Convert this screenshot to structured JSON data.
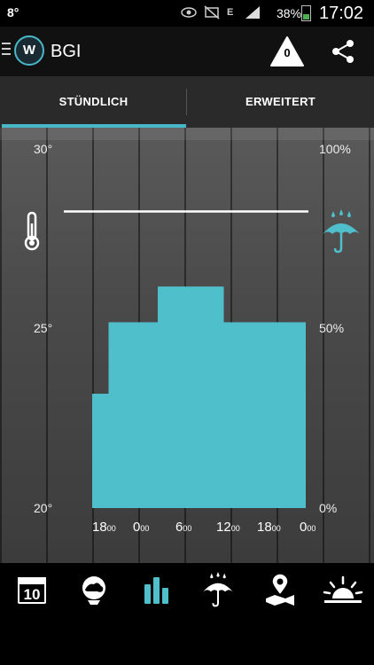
{
  "status_bar": {
    "notification": "8°",
    "battery_pct": "38%",
    "battery_level": 0.38,
    "network": "E",
    "time": "17:02"
  },
  "action_bar": {
    "title": "BGI",
    "logo_text": "W",
    "warning_count": "0"
  },
  "tabs": [
    {
      "label": "STÜNDLICH",
      "active": true
    },
    {
      "label": "ERWEITERT",
      "active": false
    }
  ],
  "chart": {
    "left_axis": {
      "top": "30°",
      "mid": "25°",
      "bottom": "20°"
    },
    "right_axis": {
      "top": "100%",
      "mid": "50%",
      "bottom": "0%"
    },
    "x_ticks": [
      {
        "hour": "18",
        "min": "00"
      },
      {
        "hour": "0",
        "min": "00"
      },
      {
        "hour": "6",
        "min": "00"
      },
      {
        "hour": "12",
        "min": "00"
      },
      {
        "hour": "18",
        "min": "00"
      },
      {
        "hour": "0",
        "min": "00"
      }
    ]
  },
  "chart_data": {
    "type": "bar",
    "temp_ylim": [
      20,
      30
    ],
    "precip_ylim": [
      0,
      100
    ],
    "temperature_line": [
      {
        "hours": 0,
        "value": 28.3
      },
      {
        "hours": 30,
        "value": 28.3
      }
    ],
    "precip_probability": [
      {
        "start": 0,
        "end": 2,
        "value": 32
      },
      {
        "start": 2,
        "end": 8,
        "value": 52
      },
      {
        "start": 8,
        "end": 16,
        "value": 62
      },
      {
        "start": 16,
        "end": 20,
        "value": 52
      },
      {
        "start": 20,
        "end": 26,
        "value": 52
      }
    ],
    "colors": {
      "bars": "#4fbfcc",
      "temp_line": "#ffffff"
    }
  },
  "bottom_nav": [
    {
      "icon": "calendar-icon",
      "label": "10",
      "active": false
    },
    {
      "icon": "world-weather-icon",
      "active": false
    },
    {
      "icon": "bar-chart-icon",
      "active": true
    },
    {
      "icon": "rain-umbrella-icon",
      "active": false
    },
    {
      "icon": "map-pin-icon",
      "active": false
    },
    {
      "icon": "sunset-icon",
      "active": false
    }
  ],
  "colors": {
    "accent": "#48b8c8"
  }
}
